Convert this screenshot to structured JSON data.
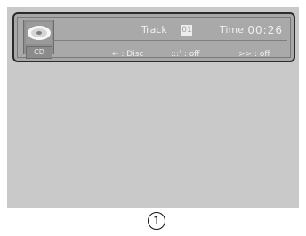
{
  "source_button": "CD",
  "track": {
    "label": "Track",
    "value": "01"
  },
  "time": {
    "label": "Time",
    "value": "00:26"
  },
  "modes": {
    "repeat": {
      "icon": "repeat-icon",
      "text": "← : Disc"
    },
    "random": {
      "icon": "random-icon",
      "text": ":::’ : off"
    },
    "scan": {
      "icon": "scan-icon",
      "text": ">> : off"
    }
  },
  "callout": "1"
}
